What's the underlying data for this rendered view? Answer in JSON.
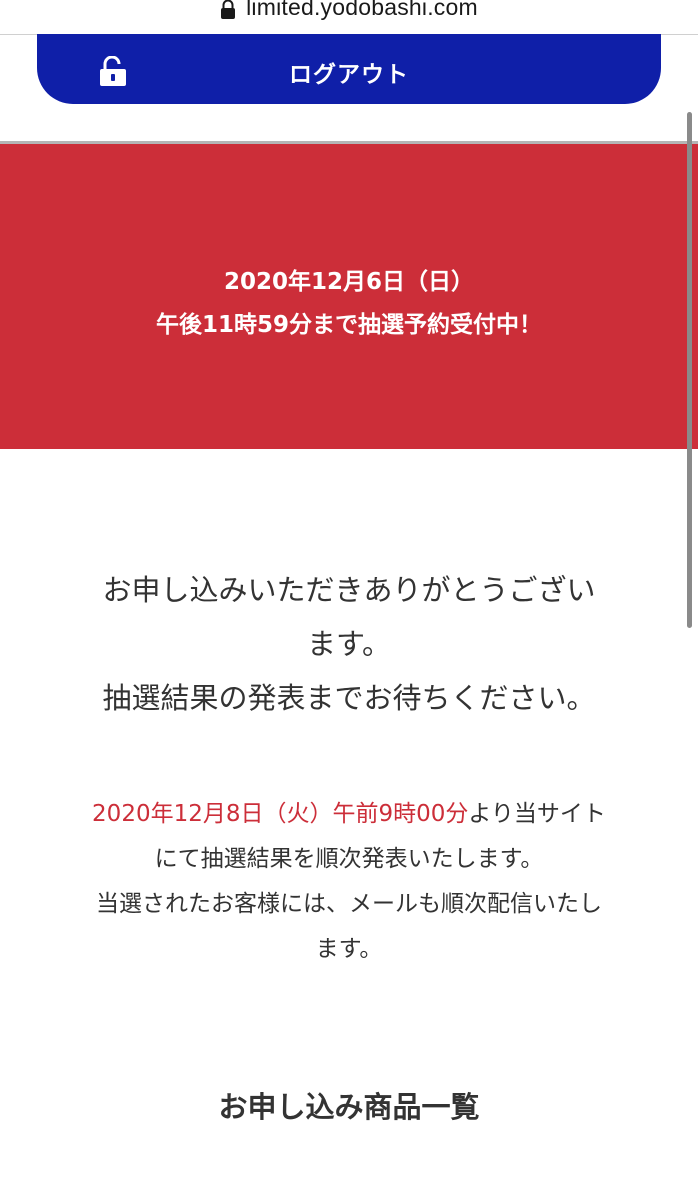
{
  "browser": {
    "url": "limited.yodobashi.com",
    "icon": "padlock-icon"
  },
  "header": {
    "logout_label": "ログアウト",
    "logout_icon": "unlock-icon",
    "button_color": "#0f1fa8"
  },
  "banner": {
    "line1": "2020年12月6日（日）",
    "line2": "午後11時59分まで抽選予約受付中！",
    "background_color": "#cc2e39"
  },
  "thanks": {
    "line1": "お申し込みいただきありがとうござい",
    "line2": "ます。",
    "line3": "抽選結果の発表までお待ちください。"
  },
  "announcement": {
    "date": "2020年12月8日（火）午前9時00分",
    "line1_rest": "より当サイト",
    "line2": "にて抽選結果を順次発表いたします。",
    "line3": "当選されたお客様には、メールも順次配信いたし",
    "line4": "ます。",
    "highlight_color": "#cc2e39"
  },
  "section": {
    "title": "お申し込み商品一覧"
  }
}
